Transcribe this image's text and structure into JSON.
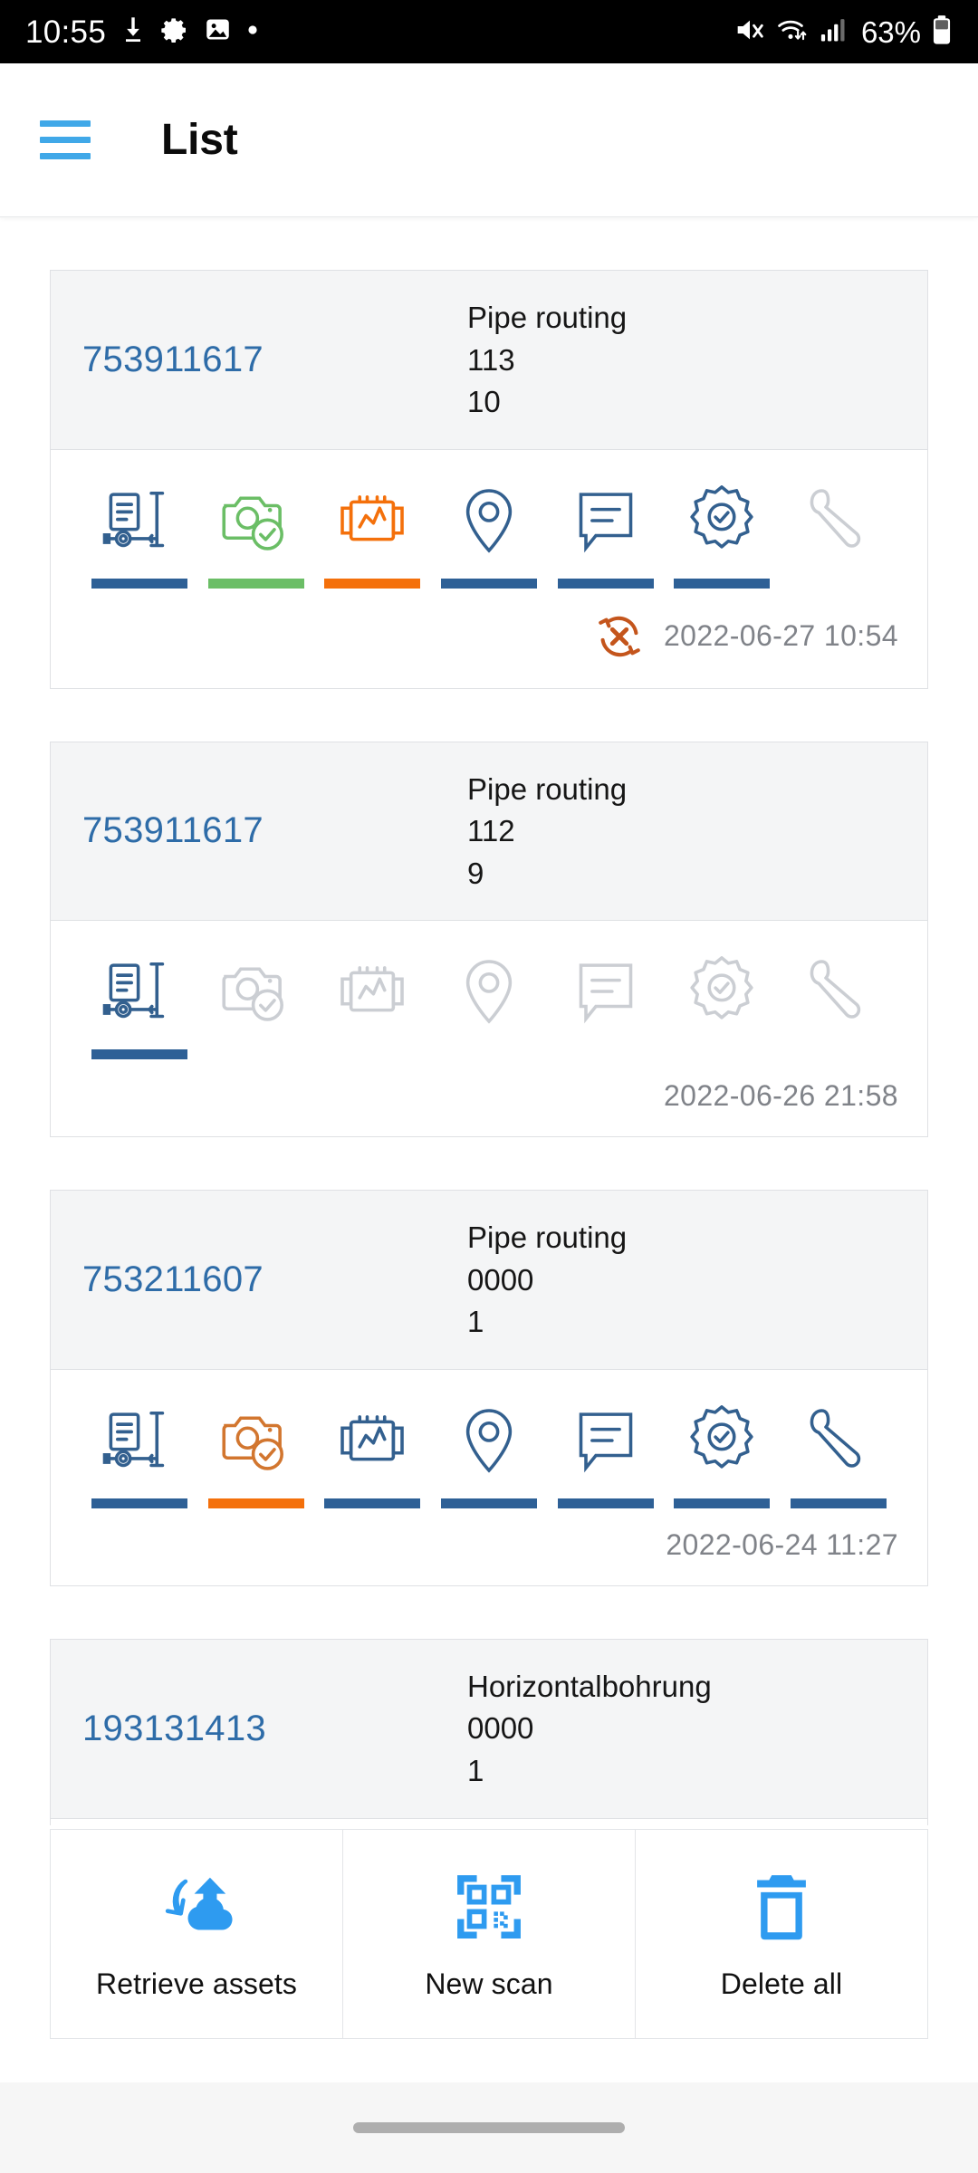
{
  "status_bar": {
    "time": "10:55",
    "left_icons": [
      "download-icon",
      "gear-icon",
      "image-icon",
      "dot-icon"
    ],
    "right_icons": [
      "mute-icon",
      "wifi-icon",
      "signal-bars-icon",
      "battery-icon"
    ],
    "battery_text": "63%"
  },
  "app_bar": {
    "menu_icon": "hamburger-menu-icon",
    "title": "List"
  },
  "colors": {
    "accent_blue": "#40A8E8",
    "id_blue": "#2E6CA8",
    "active_blue": "#2E6096",
    "active_green": "#6BBE66",
    "active_orange": "#F4700B",
    "disabled_gray": "#C9CCD1",
    "timestamp_gray": "#808389",
    "card_head_bg": "#F4F5F6"
  },
  "icon_names": [
    "asset-data-icon",
    "camera-check-icon",
    "pipe-measurement-icon",
    "location-pin-icon",
    "comment-icon",
    "certificate-check-icon",
    "wrench-icon"
  ],
  "cards": [
    {
      "id": "753911617",
      "type": "Pipe routing",
      "line2": "113",
      "line3": "10",
      "icons": [
        {
          "name": "asset-data-icon",
          "state": "blue"
        },
        {
          "name": "camera-check-icon",
          "state": "green"
        },
        {
          "name": "pipe-measurement-icon",
          "state": "orange"
        },
        {
          "name": "location-pin-icon",
          "state": "blue"
        },
        {
          "name": "comment-icon",
          "state": "blue"
        },
        {
          "name": "certificate-check-icon",
          "state": "blue"
        },
        {
          "name": "wrench-icon",
          "state": "disabled"
        }
      ],
      "sync_status": "sync-error-icon",
      "timestamp": "2022-06-27 10:54"
    },
    {
      "id": "753911617",
      "type": "Pipe routing",
      "line2": "112",
      "line3": "9",
      "icons": [
        {
          "name": "asset-data-icon",
          "state": "blue"
        },
        {
          "name": "camera-check-icon",
          "state": "disabled"
        },
        {
          "name": "pipe-measurement-icon",
          "state": "disabled"
        },
        {
          "name": "location-pin-icon",
          "state": "disabled"
        },
        {
          "name": "comment-icon",
          "state": "disabled"
        },
        {
          "name": "certificate-check-icon",
          "state": "disabled"
        },
        {
          "name": "wrench-icon",
          "state": "disabled"
        }
      ],
      "sync_status": null,
      "timestamp": "2022-06-26 21:58"
    },
    {
      "id": "753211607",
      "type": "Pipe routing",
      "line2": "0000",
      "line3": "1",
      "icons": [
        {
          "name": "asset-data-icon",
          "state": "blue"
        },
        {
          "name": "camera-check-icon",
          "state": "orange"
        },
        {
          "name": "pipe-measurement-icon",
          "state": "blue"
        },
        {
          "name": "location-pin-icon",
          "state": "blue"
        },
        {
          "name": "comment-icon",
          "state": "blue"
        },
        {
          "name": "certificate-check-icon",
          "state": "blue"
        },
        {
          "name": "wrench-icon",
          "state": "blue"
        }
      ],
      "sync_status": null,
      "timestamp": "2022-06-24 11:27"
    },
    {
      "id": "193131413",
      "type": "Horizontalbohrung",
      "line2": "0000",
      "line3": "1",
      "icons": [],
      "sync_status": null,
      "timestamp": null
    }
  ],
  "bottom_bar": {
    "items": [
      {
        "label": "Retrieve assets",
        "icon": "retrieve-cloud-icon"
      },
      {
        "label": "New scan",
        "icon": "qr-scan-icon"
      },
      {
        "label": "Delete all",
        "icon": "trash-icon"
      }
    ]
  }
}
